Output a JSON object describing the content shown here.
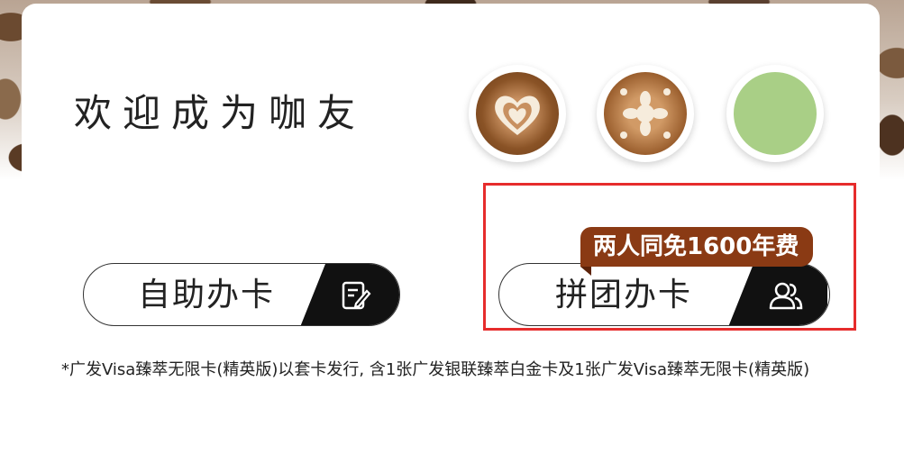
{
  "welcome_title": "欢迎成为咖友",
  "buttons": {
    "self_apply_label": "自助办卡",
    "group_apply_label": "拼团办卡",
    "group_badge": "两人同免1600年费"
  },
  "icons": {
    "self_apply_icon": "edit-form-icon",
    "group_apply_icon": "users-group-icon",
    "cups": [
      "latte-art-heart-cup",
      "latte-art-flower-cup",
      "matcha-cup"
    ]
  },
  "footnote": "*广发Visa臻萃无限卡(精英版)以套卡发行, 含1张广发银联臻萃白金卡及1张广发Visa臻萃无限卡(精英版)",
  "colors": {
    "highlight_border": "#e62c2c",
    "badge_bg": "#8a3a14",
    "button_dark": "#111111",
    "matcha": "#a9cf86"
  }
}
